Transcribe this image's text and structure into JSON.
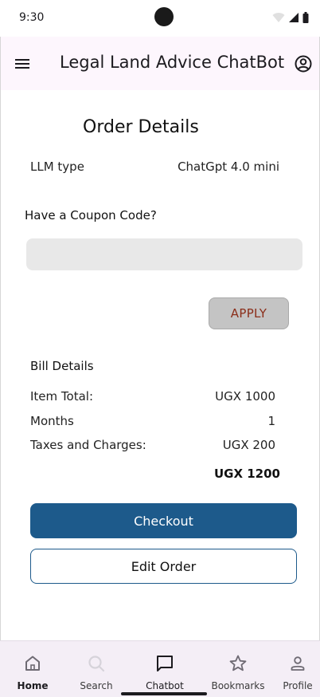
{
  "status_bar": {
    "time": "9:30",
    "icons": [
      "wifi-icon",
      "cellular-icon",
      "battery-icon"
    ]
  },
  "app_bar": {
    "title": "Legal Land Advice ChatBot",
    "menu_icon": "menu-icon",
    "account_icon": "account-circle-icon",
    "background": "#fdf6fd"
  },
  "order": {
    "title": "Order Details",
    "llm_label": "LLM type",
    "llm_value": "ChatGpt 4.0 mini"
  },
  "coupon": {
    "label": "Have a Coupon Code?",
    "value": "",
    "placeholder": "",
    "apply_label": "APPLY"
  },
  "bill": {
    "title": "Bill Details",
    "rows": [
      {
        "label": "Item Total:",
        "value": "UGX 1000"
      },
      {
        "label": "Months",
        "value": "1"
      },
      {
        "label": "Taxes and Charges:",
        "value": "UGX 200"
      }
    ],
    "total": "UGX 1200"
  },
  "actions": {
    "checkout_label": "Checkout",
    "edit_label": "Edit Order"
  },
  "bottom_nav": {
    "items": [
      {
        "label": "Home",
        "icon": "home-icon",
        "state": "bold"
      },
      {
        "label": "Search",
        "icon": "search-icon",
        "state": "dim"
      },
      {
        "label": "Chatbot",
        "icon": "chat-icon",
        "state": "active"
      },
      {
        "label": "Bookmarks",
        "icon": "star-icon",
        "state": "normal"
      },
      {
        "label": "Profile",
        "icon": "person-icon",
        "state": "normal"
      }
    ]
  },
  "colors": {
    "primary": "#1d5a8b",
    "apply_text": "#8b2e1a",
    "apply_bg": "#c4c4c4",
    "input_bg": "#e8e8e8",
    "nav_bg": "#f4eef6"
  }
}
